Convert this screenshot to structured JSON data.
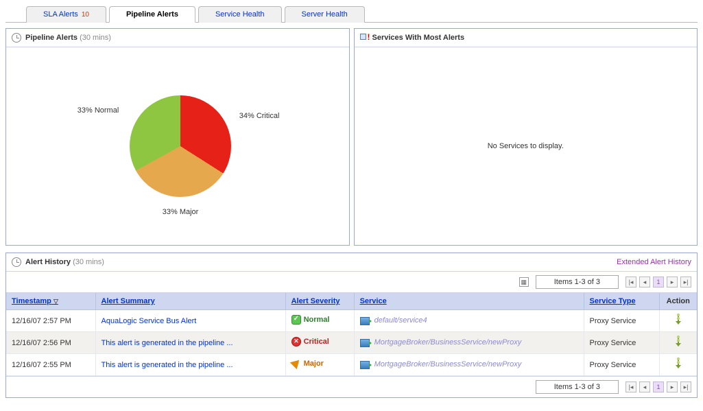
{
  "tabs": [
    {
      "label": "SLA Alerts",
      "count": "10",
      "active": false
    },
    {
      "label": "Pipeline Alerts",
      "count": "",
      "active": true
    },
    {
      "label": "Service Health",
      "count": "",
      "active": false
    },
    {
      "label": "Server Health",
      "count": "",
      "active": false
    }
  ],
  "panels": {
    "pipeline": {
      "title": "Pipeline Alerts",
      "subtitle": "(30 mins)"
    },
    "services": {
      "title": "Services With Most Alerts",
      "empty": "No Services to display."
    }
  },
  "chart_data": {
    "type": "pie",
    "title": "Pipeline Alerts (30 mins)",
    "series": [
      {
        "name": "Critical",
        "value": 34,
        "label": "34% Critical",
        "color": "#e62117"
      },
      {
        "name": "Major",
        "value": 33,
        "label": "33% Major",
        "color": "#e6a84d"
      },
      {
        "name": "Normal",
        "value": 33,
        "label": "33% Normal",
        "color": "#8ec641"
      }
    ]
  },
  "history": {
    "title": "Alert History",
    "subtitle": "(30 mins)",
    "extended_link": "Extended Alert History",
    "range": "Items 1-3 of 3",
    "columns": {
      "timestamp": "Timestamp",
      "summary": "Alert Summary",
      "severity": "Alert Severity",
      "service": "Service",
      "service_type": "Service Type",
      "action": "Action"
    },
    "rows": [
      {
        "timestamp": "12/16/07 2:57 PM",
        "summary": "AquaLogic Service Bus Alert",
        "severity": "Normal",
        "service": "default/service4",
        "service_type": "Proxy Service"
      },
      {
        "timestamp": "12/16/07 2:56 PM",
        "summary": "This alert is generated in the pipeline ...",
        "severity": "Critical",
        "service": "MortgageBroker/BusinessService/newProxy",
        "service_type": "Proxy Service"
      },
      {
        "timestamp": "12/16/07 2:55 PM",
        "summary": "This alert is generated in the pipeline ...",
        "severity": "Major",
        "service": "MortgageBroker/BusinessService/newProxy",
        "service_type": "Proxy Service"
      }
    ],
    "page_current": "1"
  }
}
